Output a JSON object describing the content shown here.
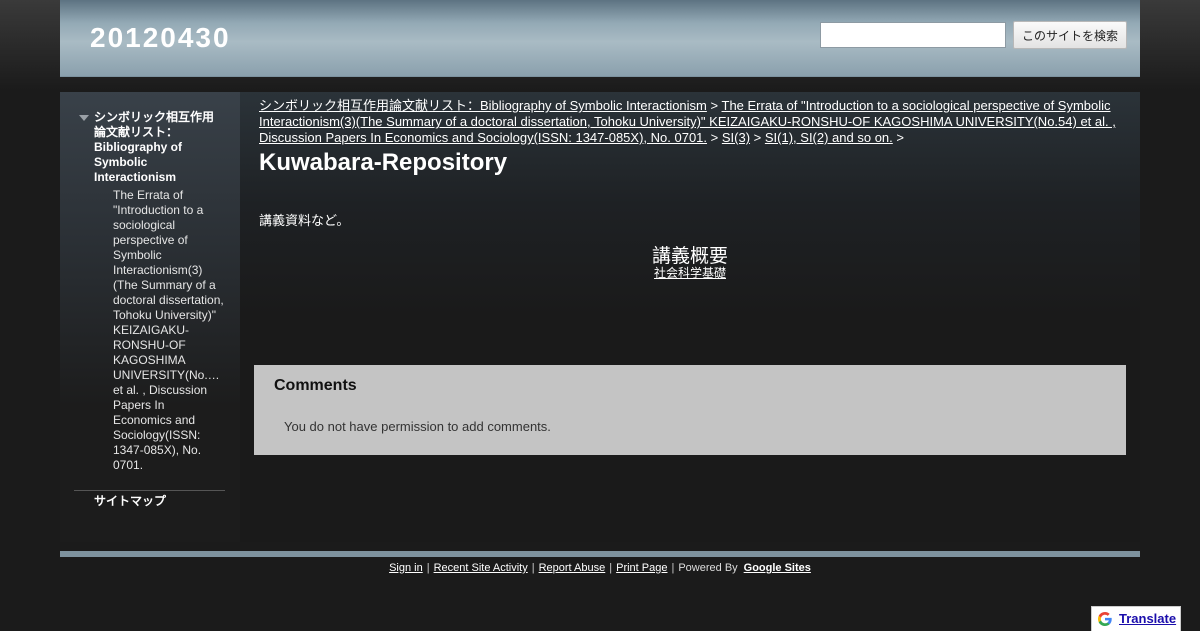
{
  "header": {
    "site_title": "20120430",
    "search_placeholder": "",
    "search_button": "このサイトを検索"
  },
  "sidebar": {
    "top_item": "シンボリック相互作用論文献リスト：Bibliography of Symbolic Interactionism",
    "sub_item": "The Errata of \"Introduction to a sociological perspective of Symbolic Interactionism(3)(The Summary of a doctoral dissertation, Tohoku University)\" KEIZAIGAKU-RONSHU-OF KAGOSHIMA UNIVERSITY(No.… et al. , Discussion Papers In Economics and Sociology(ISSN: 1347-085X), No. 0701.",
    "sitemap": "サイトマップ"
  },
  "breadcrumb": {
    "item1": "シンボリック相互作用論文献リスト：Bibliography of Symbolic Interactionism",
    "item2": "The Errata of \"Introduction to a sociological perspective of Symbolic Interactionism(3)(The Summary of a doctoral dissertation, Tohoku University)\" KEIZAIGAKU-RONSHU-OF KAGOSHIMA UNIVERSITY(No.54) et al. , Discussion Papers In Economics and Sociology(ISSN: 1347-085X), No. 0701.",
    "item3": "SI(3)",
    "item4": "SI(1), SI(2) and so on.",
    "separator": ">"
  },
  "main": {
    "page_title": "Kuwabara-Repository",
    "body_text": "講義資料など。",
    "lecture_heading": "講義概要",
    "lecture_link": "社会科学基礎"
  },
  "comments": {
    "title": "Comments",
    "message": "You do not have permission to add comments."
  },
  "footer": {
    "sign_in": "Sign in",
    "recent_activity": "Recent Site Activity",
    "report_abuse": "Report Abuse",
    "print_page": "Print Page",
    "powered_by": "Powered By",
    "google_sites": "Google Sites",
    "separator": "|"
  },
  "translate": {
    "label": "Translate"
  },
  "colors": {
    "header_gradient_mid": "#a9bbc4",
    "comments_bg": "#c4c4c4",
    "footer_bar": "#7e929e",
    "page_bg": "#1b1b1b"
  }
}
